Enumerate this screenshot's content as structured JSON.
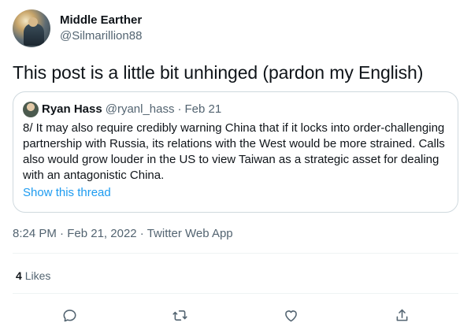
{
  "author": {
    "display_name": "Middle Earther",
    "handle": "@Silmarillion88",
    "avatar_icon": "avatar-illustration-icon"
  },
  "tweet": {
    "text": "This post is a little bit unhinged (pardon my English)"
  },
  "quoted_tweet": {
    "author_name": "Ryan Hass",
    "author_handle": "@ryanl_hass",
    "separator": "·",
    "date": "Feb 21",
    "text": "8/ It may also require credibly warning China that if it locks into order-challenging partnership with Russia, its relations with the West would be more strained. Calls also would grow louder in the US to view Taiwan as a strategic asset for dealing with an antagonistic China.",
    "show_thread_label": "Show this thread"
  },
  "meta": {
    "time": "8:24 PM",
    "sep1": " · ",
    "date": "Feb 21, 2022",
    "sep2": " · ",
    "source": "Twitter Web App"
  },
  "engagement": {
    "likes_count": "4",
    "likes_label": "Likes"
  },
  "actions": {
    "reply_icon": "reply-icon",
    "retweet_icon": "retweet-icon",
    "like_icon": "like-heart-icon",
    "share_icon": "share-icon"
  },
  "colors": {
    "link": "#1d9bf0",
    "secondary_text": "#536471",
    "border": "#cfd9de"
  }
}
